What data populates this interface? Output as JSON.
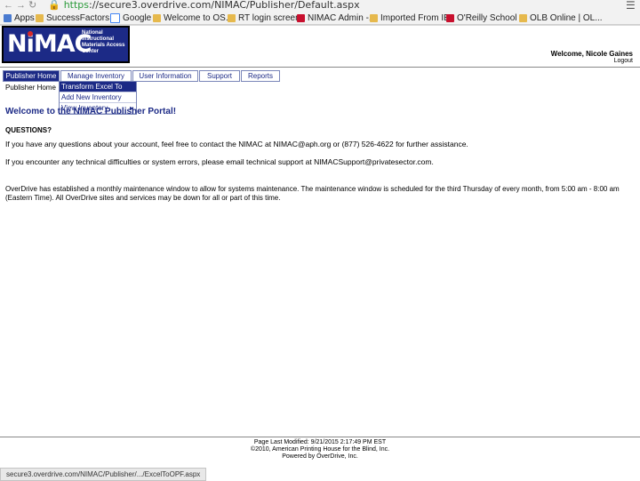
{
  "browser": {
    "url_scheme": "https",
    "url_rest": "://secure3.overdrive.com/NIMAC/Publisher/Default.aspx",
    "bookmarks": [
      {
        "label": "Apps",
        "icon": "apps-icon"
      },
      {
        "label": "SuccessFactors ...",
        "icon": "folder-icon"
      },
      {
        "label": "Google",
        "icon": "google-icon"
      },
      {
        "label": "Welcome to OS...",
        "icon": "folder-icon"
      },
      {
        "label": "RT login screen",
        "icon": "folder-icon"
      },
      {
        "label": "NIMAC Admin -...",
        "icon": "nimac-icon"
      },
      {
        "label": "Imported From IE",
        "icon": "folder-icon"
      },
      {
        "label": "O'Reilly School ...",
        "icon": "oreilly-icon"
      },
      {
        "label": "OLB Online | OL...",
        "icon": "folder-icon"
      }
    ],
    "status_url": "secure3.overdrive.com/NIMAC/Publisher/.../ExcelToOPF.aspx"
  },
  "header": {
    "logo_text": "NiMAC",
    "logo_subtitle": "National Instructional Materials Access Center",
    "welcome": "Welcome, Nicole Gaines",
    "logout": "Logout"
  },
  "nav": {
    "items": [
      "Publisher Home",
      "Manage Inventory",
      "User Information",
      "Support",
      "Reports"
    ],
    "sublabel": "Publisher Home",
    "dropdown": [
      "Transform Excel To OPF",
      "Add New Inventory",
      "View Inventory"
    ],
    "dropdown_arrow": "▸"
  },
  "content": {
    "title": "Welcome to the NIMAC Publisher Portal!",
    "questions": "QUESTIONS?",
    "para1": "If you have any questions about your account, feel free to contact the NIMAC at NIMAC@aph.org or (877) 526-4622 for further assistance.",
    "para2": "If you encounter any technical difficulties or system errors, please email technical support at NIMACSupport@privatesector.com.",
    "para3": "OverDrive has established a monthly maintenance window to allow for systems maintenance. The maintenance window is scheduled for the third Thursday of every month, from 5:00 am - 8:00 am (Eastern Time). All OverDrive sites and services may be down for all or part of this time."
  },
  "footer": {
    "modified": "Page Last Modified: 9/21/2015 2:17:49 PM EST",
    "copyright": "©2010, American Printing House for the Blind, Inc.",
    "powered": "Powered by OverDrive, Inc."
  },
  "colors": {
    "navy": "#1c2a86",
    "link_green": "#2b9a3a"
  }
}
